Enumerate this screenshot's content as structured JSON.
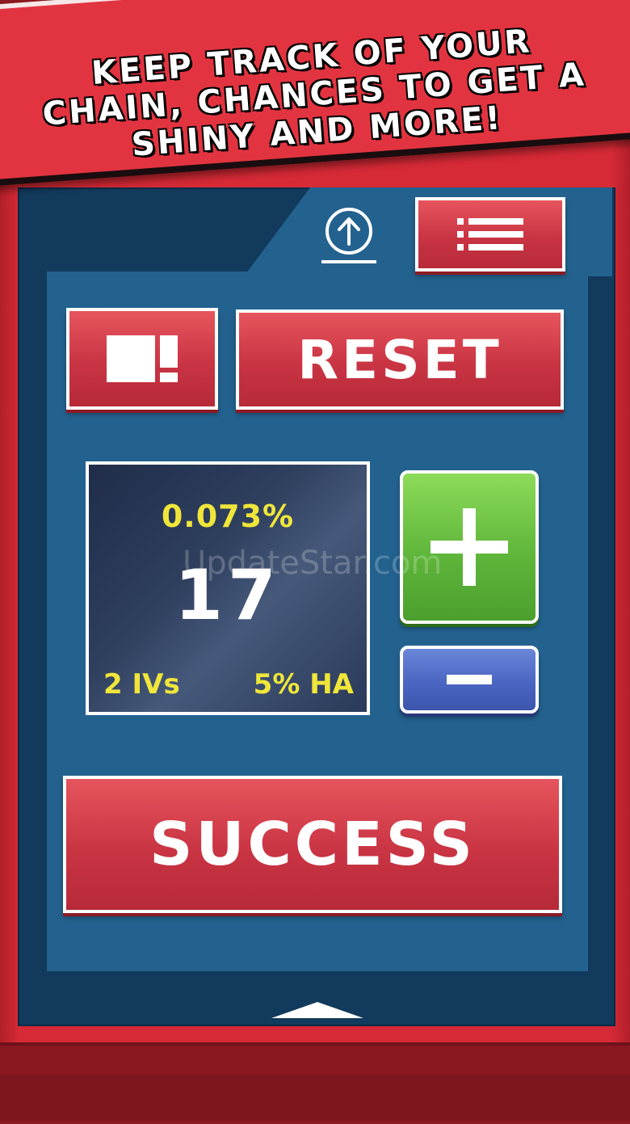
{
  "banner": {
    "text": "KEEP TRACK OF YOUR CHAIN, CHANCES TO GET A SHINY AND MORE!"
  },
  "toolbar": {
    "upload_icon": "upload-circle-icon",
    "menu_icon": "list-menu-icon"
  },
  "controls": {
    "toggle_icon": "layout-toggle-icon",
    "reset_label": "RESET"
  },
  "counter": {
    "chance": "0.073%",
    "count": "17",
    "ivs": "2 IVs",
    "ha": "5% HA"
  },
  "watermark": "UpdateStar.com",
  "success_label": "SUCCESS",
  "colors": {
    "frame_red": "#d62a36",
    "screen_blue": "#23628f",
    "plus_green": "#5fb63a",
    "minus_blue": "#4a66c2",
    "chance_yellow": "#f0e63a"
  }
}
